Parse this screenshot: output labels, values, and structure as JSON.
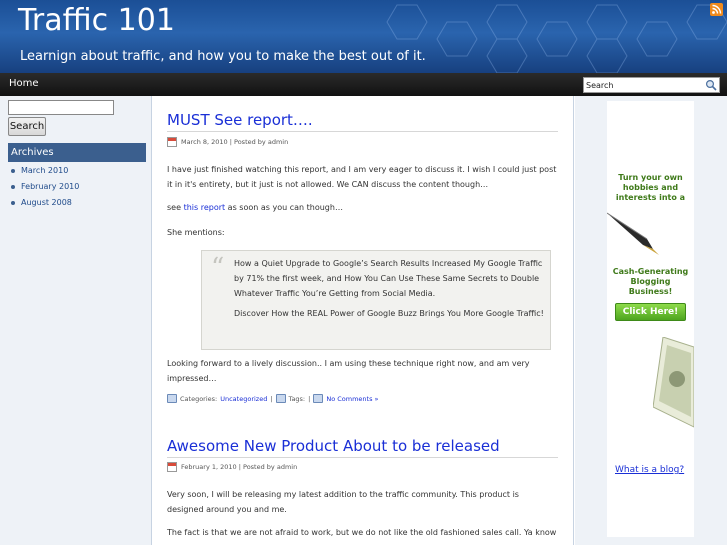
{
  "header": {
    "title": "Traffic 101",
    "description": "Learnign about traffic, and how you to make the best out of it."
  },
  "nav": {
    "home_label": "Home",
    "search_value": "Search"
  },
  "left_sidebar": {
    "search_button": "Search",
    "archives_title": "Archives",
    "archives": [
      "March 2010",
      "February 2010",
      "August 2008"
    ]
  },
  "posts": [
    {
      "title": "MUST See report….",
      "meta": "March 8, 2010 | Posted by admin",
      "p1": "I have just finished watching this report, and I am very eager to discuss it.  I wish I could just post it in it's entirety, but it just is not allowed.  We CAN discuss the content though…",
      "p2_before": "see ",
      "p2_link": "this report",
      "p2_after": " as soon as you can though…",
      "p3": "She mentions:",
      "quote1": "How a Quiet Upgrade to Google’s Search Results Increased My Google Traffic by 71% the first week, and How You Can Use These Same Secrets to Double Whatever Traffic You’re Getting from Social Media.",
      "quote2": "Discover How the REAL Power of Google Buzz Brings You More Google Traffic!",
      "p4": "Looking forward to a lively discussion..  I am using these technique right now, and am very impressed…",
      "categories_label": "Categories:",
      "category": "Uncategorized",
      "tags_label": "Tags:",
      "comments": "No Comments »"
    },
    {
      "title": "Awesome New Product About to be released",
      "meta": "February 1, 2010 | Posted by admin",
      "p1": "Very soon, I will be releasing my latest addition to the traffic community.  This product is designed around you and me.",
      "p2": "The fact is that we are not afraid to work, but we do not like the old fashioned sales call.  Ya know"
    }
  ],
  "ad": {
    "text1": "Turn your own hobbies and interests into a",
    "text2": "Cash-Generating Blogging Business!",
    "button": "Click Here!",
    "link": "What is a blog?"
  },
  "colors": {
    "header_blue": "#2a64ae",
    "nav_dark": "#1a1a1a",
    "link_blue": "#1a2fd6",
    "ad_green": "#3f7a1a",
    "rss_orange": "#f08a1c"
  }
}
